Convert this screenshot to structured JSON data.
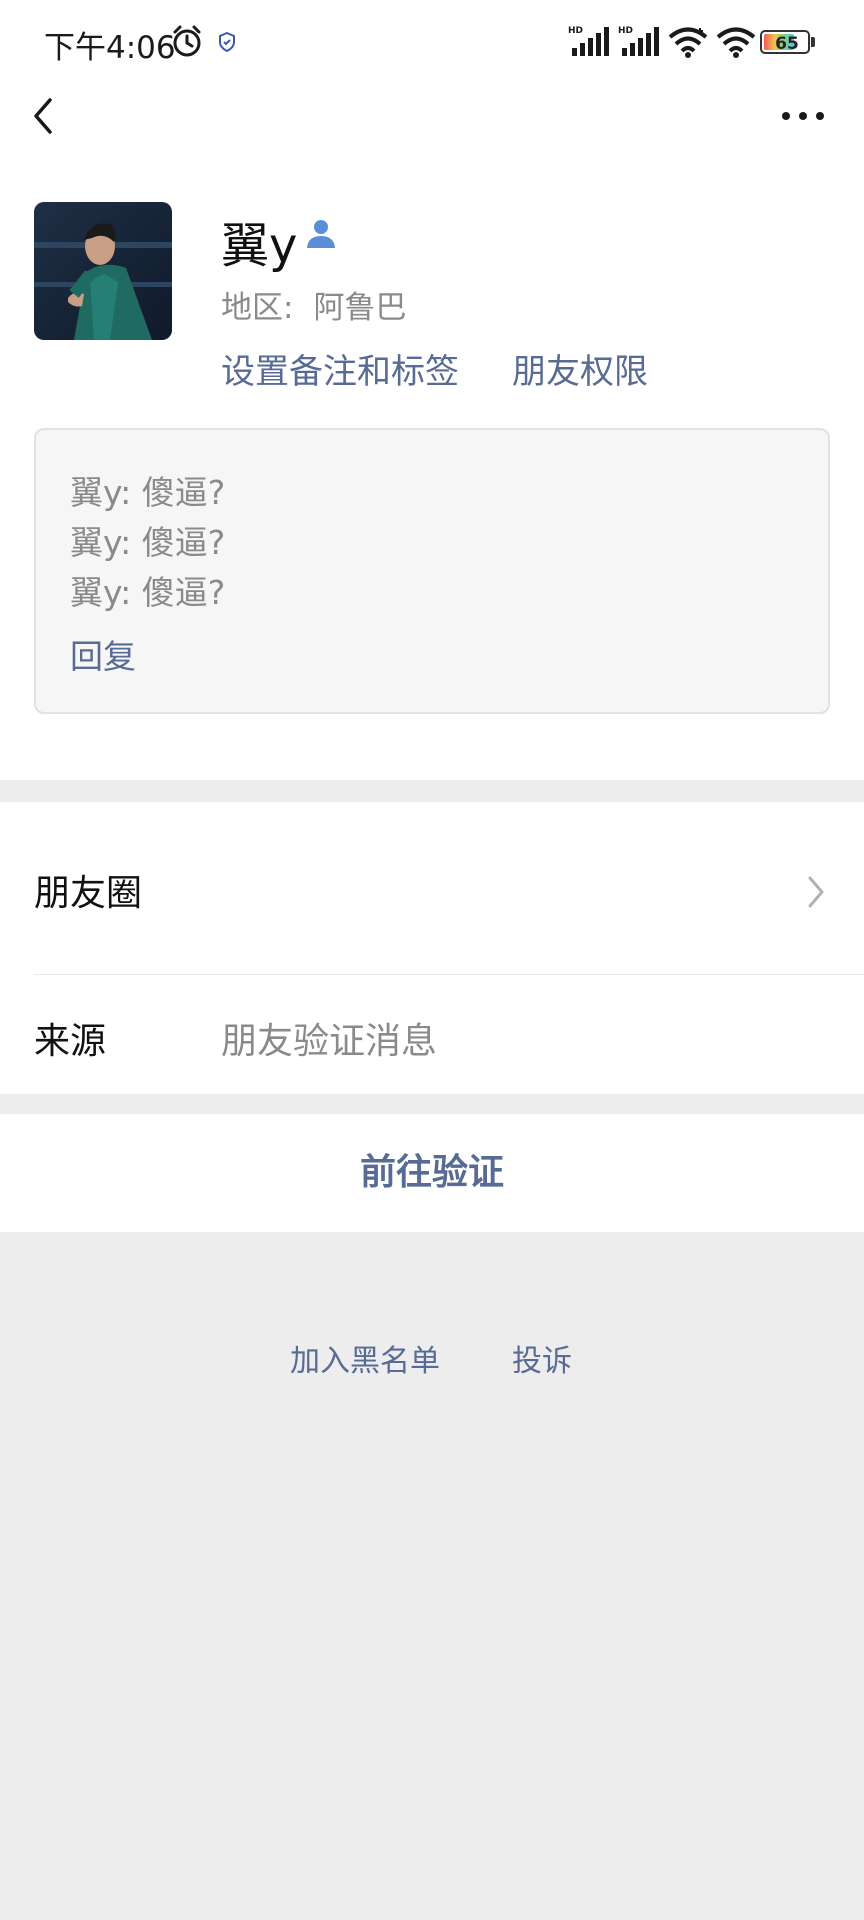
{
  "status_bar": {
    "time": "下午4:06",
    "battery_level": "65",
    "icons": [
      "alarm-icon",
      "shield-icon",
      "signal-hd-icon",
      "signal-hd-icon",
      "wifi-icon",
      "wifi-icon",
      "battery-icon"
    ]
  },
  "nav": {
    "back_icon": "chevron-left-icon",
    "more_icon": "more-dots-icon"
  },
  "profile": {
    "name": "翼y",
    "name_badge_icon": "contact-person-icon",
    "region_label": "地区:",
    "region_value": "阿鲁巴",
    "actions": [
      "设置备注和标签",
      "朋友权限"
    ]
  },
  "message_card": {
    "lines": [
      "翼y: 傻逼?",
      "翼y: 傻逼?",
      "翼y: 傻逼?"
    ],
    "reply_label": "回复"
  },
  "rows": {
    "moments_label": "朋友圈",
    "source_label": "来源",
    "source_value": "朋友验证消息"
  },
  "verify_button": "前往验证",
  "bottom_links": [
    "加入黑名单",
    "投诉"
  ],
  "colors": {
    "link": "#576b95",
    "background": "#ededed",
    "contact_icon": "#5a8fd8"
  }
}
